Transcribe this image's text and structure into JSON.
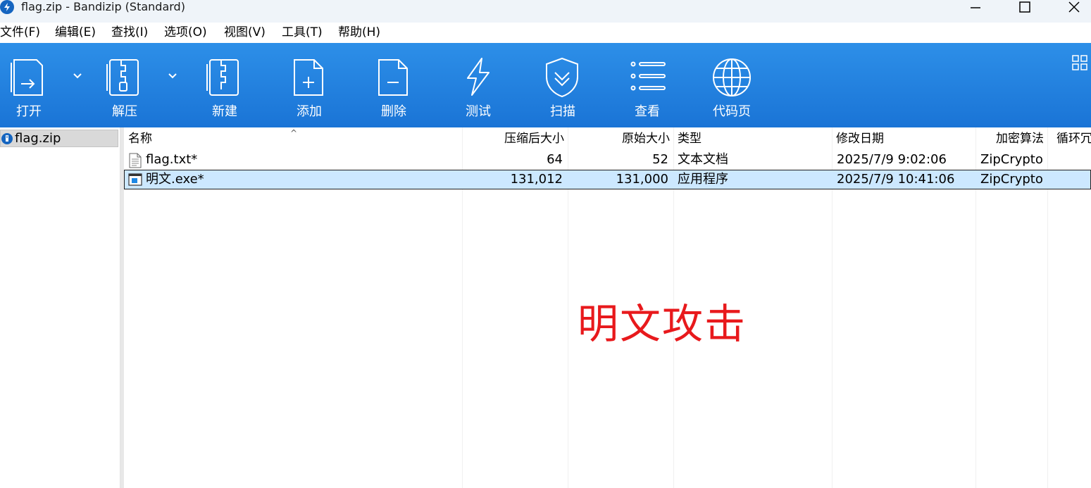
{
  "window": {
    "title": "flag.zip - Bandizip (Standard)"
  },
  "menu": [
    "文件(F)",
    "编辑(E)",
    "查找(I)",
    "选项(O)",
    "视图(V)",
    "工具(T)",
    "帮助(H)"
  ],
  "toolbar": {
    "open": "打开",
    "extract": "解压",
    "new": "新建",
    "add": "添加",
    "delete": "删除",
    "test": "测试",
    "scan": "扫描",
    "view": "查看",
    "codepage": "代码页"
  },
  "tree": {
    "item": "flag.zip"
  },
  "columns": [
    "名称",
    "压缩后大小",
    "原始大小",
    "类型",
    "修改日期",
    "加密算法",
    "循环冗"
  ],
  "files": [
    {
      "name": "flag.txt*",
      "compressed": "64",
      "original": "52",
      "type": "文本文档",
      "modified": "2025/7/9 9:02:06",
      "encryption": "ZipCrypto"
    },
    {
      "name": "明文.exe*",
      "compressed": "131,012",
      "original": "131,000",
      "type": "应用程序",
      "modified": "2025/7/9 10:41:06",
      "encryption": "ZipCrypto"
    }
  ],
  "overlay": "明文攻击",
  "colors": {
    "toolbar": "#1a74d6",
    "selection": "#cce8ff",
    "overlay": "#e8191c"
  }
}
